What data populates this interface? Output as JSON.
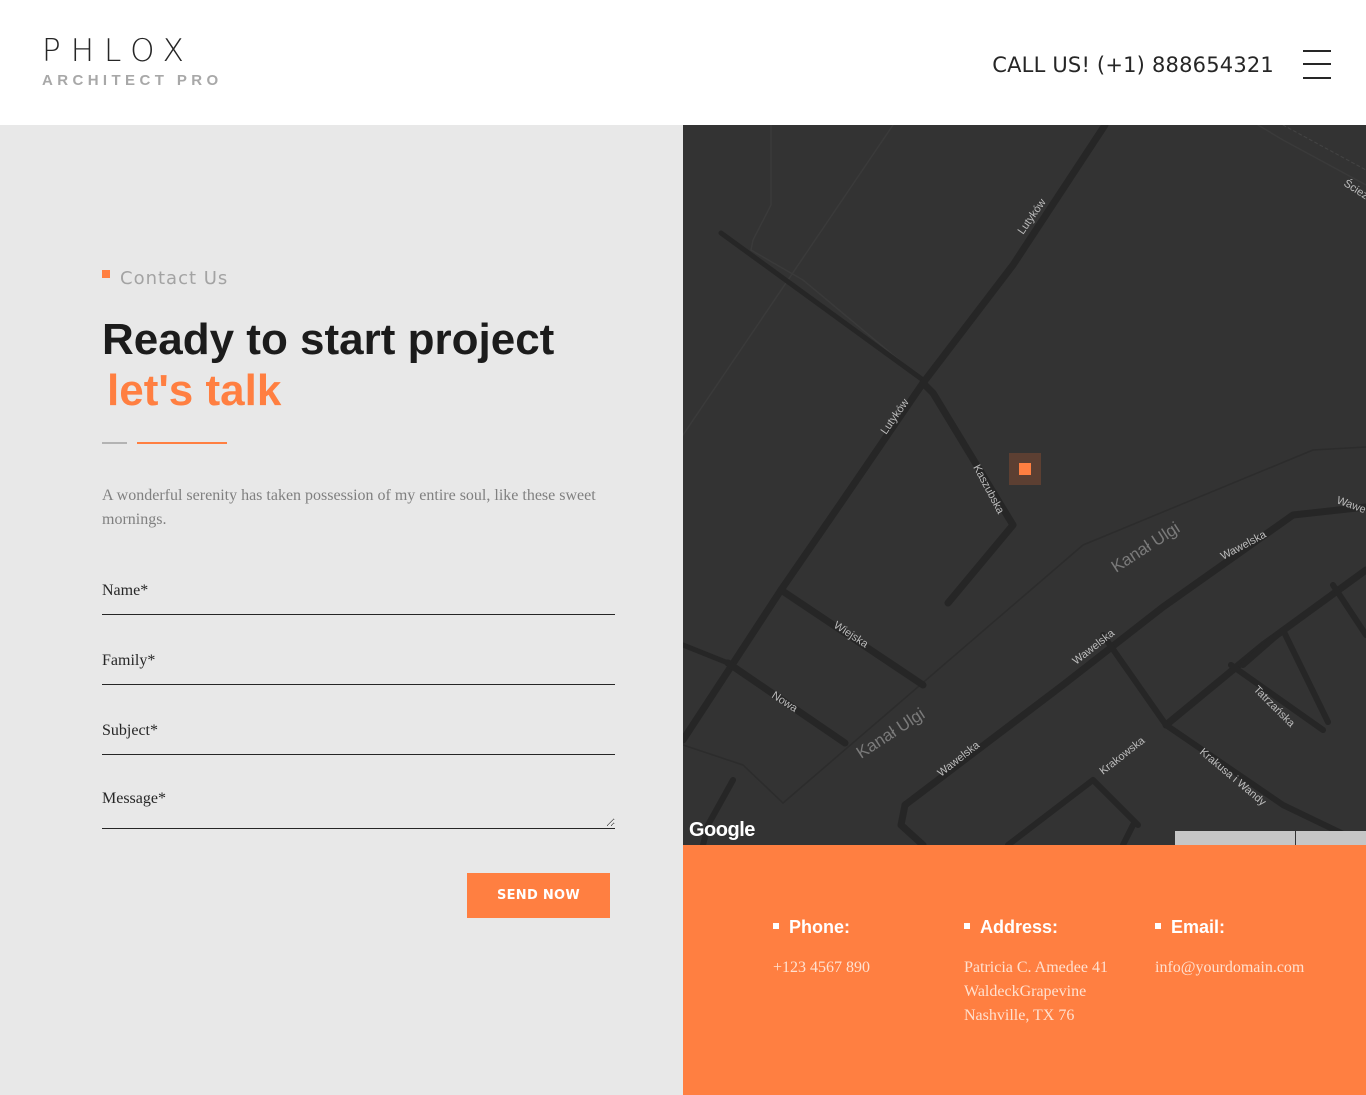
{
  "header": {
    "logo_main": "PHLOX",
    "logo_sub": "ARCHITECT PRO",
    "call": "CALL US! (+1) 888654321"
  },
  "contact": {
    "eyebrow": "Contact Us",
    "headline_line1": "Ready to start project",
    "headline_line2": "let's talk",
    "lead": "A wonderful serenity has taken possession of my entire soul, like these sweet mornings.",
    "form": {
      "name_placeholder": "Name*",
      "family_placeholder": "Family*",
      "subject_placeholder": "Subject*",
      "message_placeholder": "Message*",
      "send_label": "SEND NOW"
    }
  },
  "map": {
    "provider": "Google",
    "streets": [
      "Lutyków",
      "Lutyków",
      "Kaszubska",
      "Kanał Ulgi",
      "Kanał Ulgi",
      "Wawelska",
      "Wawelska",
      "Wawelska",
      "Wiejska",
      "Nowa",
      "Krakowska",
      "Tatrzańska",
      "Krakusa i Wandy",
      "Ściez",
      "Wawe"
    ]
  },
  "info": {
    "phone_title": "Phone:",
    "phone": "+123 4567 890",
    "address_title": "Address:",
    "address_line1": "Patricia C. Amedee 41",
    "address_line2": "WaldeckGrapevine",
    "address_line3": "Nashville, TX 76",
    "email_title": "Email:",
    "email": "info@yourdomain.com"
  },
  "colors": {
    "accent": "#ff7f41",
    "text_dark": "#1c1c1c",
    "panel_bg": "#e8e8e8",
    "map_bg": "#333333"
  }
}
